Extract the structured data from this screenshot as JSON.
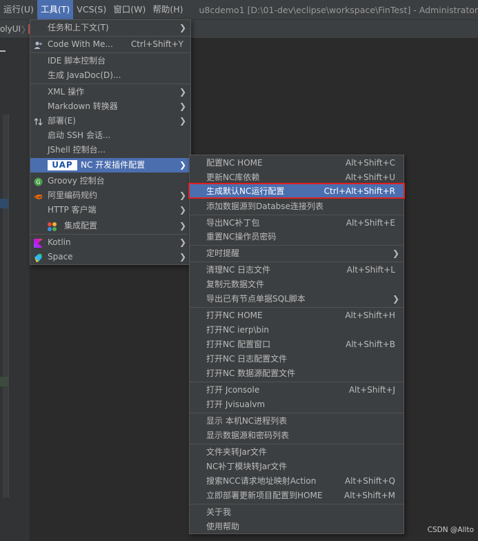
{
  "menubar": {
    "items": [
      {
        "label": "运行(U)",
        "active": false
      },
      {
        "label": "工具(T)",
        "active": true
      },
      {
        "label": "VCS(S)",
        "active": false
      },
      {
        "label": "窗口(W)",
        "active": false
      },
      {
        "label": "帮助(H)",
        "active": false
      }
    ],
    "window_title": "u8cdemo1 [D:\\01-dev\\eclipse\\workspace\\FinTest] - Administrator"
  },
  "navbar": {
    "crumb": "olyUI",
    "sep": "〉"
  },
  "tools_menu": {
    "items": [
      {
        "label": "任务和上下文(T)",
        "submenu": true
      },
      {
        "label": "Code With Me...",
        "shortcut": "Ctrl+Shift+Y",
        "icon": "person-icon"
      },
      {
        "label": "IDE 脚本控制台"
      },
      {
        "label": "生成 JavaDoc(D)..."
      },
      {
        "label": "XML 操作",
        "submenu": true
      },
      {
        "label": "Markdown 转换器",
        "submenu": true
      },
      {
        "label": "部署(E)",
        "submenu": true,
        "icon": "deploy-arrows-icon"
      },
      {
        "label": "启动 SSH 会话..."
      },
      {
        "label": "JShell 控制台..."
      },
      {
        "label": "NC 开发插件配置",
        "submenu": true,
        "highlighted": true,
        "logo": "UAP"
      },
      {
        "label": "Groovy 控制台",
        "icon": "groovy-icon"
      },
      {
        "label": "阿里编码规约",
        "submenu": true,
        "icon": "alibaba-icon"
      },
      {
        "label": "HTTP 客户端",
        "submenu": true
      },
      {
        "label": "集成配置",
        "submenu": true,
        "icon": "integration-icon"
      },
      {
        "label": "Kotlin",
        "submenu": true,
        "icon": "kotlin-icon"
      },
      {
        "label": "Space",
        "submenu": true,
        "icon": "space-icon"
      }
    ]
  },
  "nc_menu": {
    "items": [
      {
        "label": "配置NC HOME",
        "shortcut": "Alt+Shift+C"
      },
      {
        "label": "更新NC库依赖",
        "shortcut": "Alt+Shift+U"
      },
      {
        "label": "生成默认NC运行配置",
        "shortcut": "Ctrl+Alt+Shift+R",
        "highlighted": true
      },
      {
        "label": "添加数据源到Databse连接列表"
      },
      {
        "label": "导出NC补丁包",
        "shortcut": "Alt+Shift+E"
      },
      {
        "label": "重置NC操作员密码"
      },
      {
        "label": "定时提醒",
        "submenu": true
      },
      {
        "label": "清理NC 日志文件",
        "shortcut": "Alt+Shift+L"
      },
      {
        "label": "复制元数据文件"
      },
      {
        "label": "导出已有节点单据SQL脚本",
        "submenu": true
      },
      {
        "label": "打开NC HOME",
        "shortcut": "Alt+Shift+H"
      },
      {
        "label": "打开NC ierp\\bin"
      },
      {
        "label": "打开NC 配置窗口",
        "shortcut": "Alt+Shift+B"
      },
      {
        "label": "打开NC 日志配置文件"
      },
      {
        "label": "打开NC 数据源配置文件"
      },
      {
        "label": "打开 Jconsole",
        "shortcut": "Alt+Shift+J"
      },
      {
        "label": "打开 Jvisualvm"
      },
      {
        "label": "显示 本机NC进程列表"
      },
      {
        "label": "显示数据源和密码列表"
      },
      {
        "label": "文件夹转Jar文件"
      },
      {
        "label": "NC补丁模块转Jar文件"
      },
      {
        "label": "搜索NCC请求地址映射Action",
        "shortcut": "Alt+Shift+Q"
      },
      {
        "label": "立即部署更新项目配置到HOME",
        "shortcut": "Alt+Shift+M"
      },
      {
        "label": "关于我"
      },
      {
        "label": "使用帮助"
      }
    ]
  },
  "watermark": "CSDN @Allto",
  "colors": {
    "menu_bg": "#3c3f41",
    "highlight": "#4b6eaf",
    "text": "#bbbbbb",
    "red_box": "#e02020"
  }
}
